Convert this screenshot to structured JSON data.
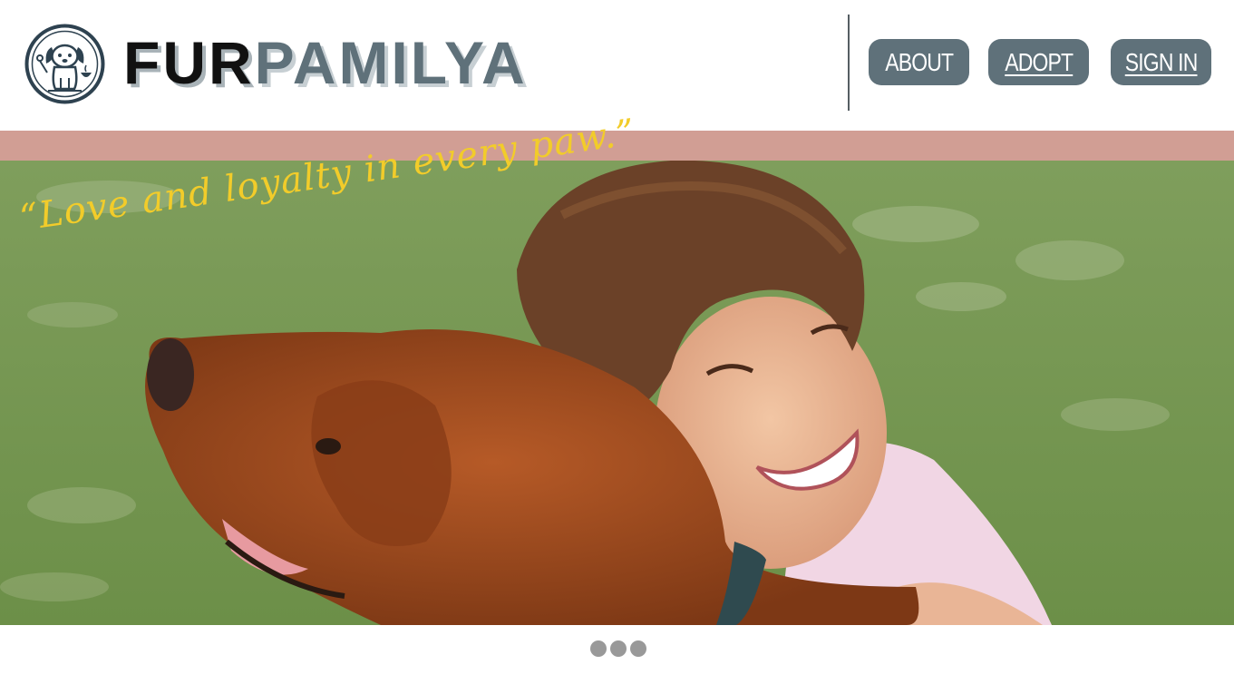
{
  "brand": {
    "part1": "FUR",
    "part2": "PAMILYA",
    "logo_icon": "puppy-badge-icon"
  },
  "nav": {
    "about": "ABOUT",
    "adopt": "ADOPT",
    "sign_in": "SIGN IN"
  },
  "hero": {
    "tagline": "“Love and loyalty in every paw.”",
    "image": "boy-hugging-golden-retriever"
  },
  "carousel": {
    "dot_count": 3,
    "active_index": 0
  },
  "colors": {
    "brand_slate": "#5f717a",
    "band_rose": "#d19e94",
    "tagline_yellow": "#f2cc2a",
    "dot_gray": "#999999"
  }
}
